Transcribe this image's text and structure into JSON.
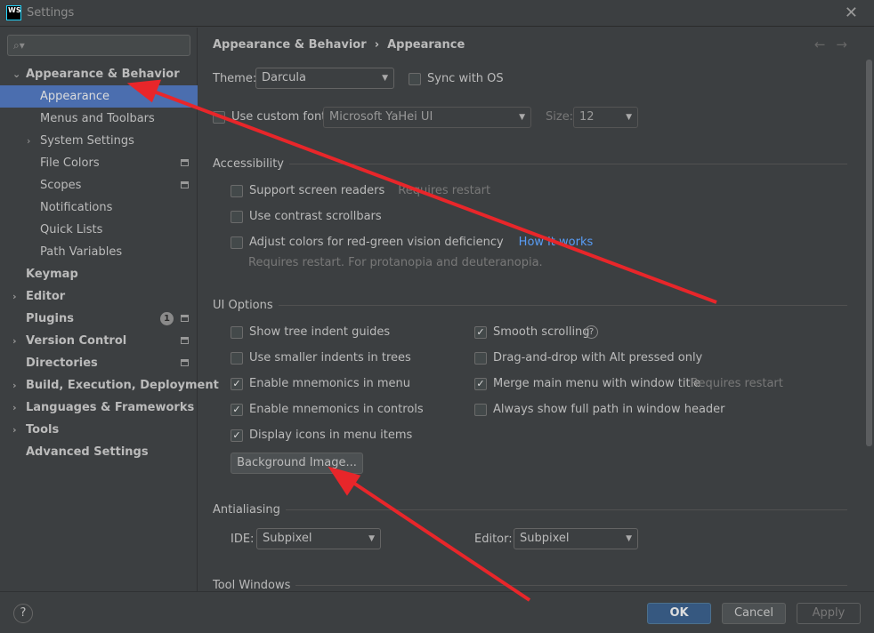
{
  "window": {
    "title": "Settings",
    "logo": "WS"
  },
  "sidebar": {
    "search_placeholder": "",
    "items": [
      {
        "label": "Appearance & Behavior",
        "level": 0,
        "bold": true,
        "expanded": true
      },
      {
        "label": "Appearance",
        "level": 1,
        "selected": true
      },
      {
        "label": "Menus and Toolbars",
        "level": 1
      },
      {
        "label": "System Settings",
        "level": 1,
        "collapsed": true
      },
      {
        "label": "File Colors",
        "level": 1,
        "icon": true
      },
      {
        "label": "Scopes",
        "level": 1,
        "icon": true
      },
      {
        "label": "Notifications",
        "level": 1
      },
      {
        "label": "Quick Lists",
        "level": 1
      },
      {
        "label": "Path Variables",
        "level": 1
      },
      {
        "label": "Keymap",
        "level": 0,
        "bold": true
      },
      {
        "label": "Editor",
        "level": 0,
        "bold": true,
        "collapsed": true
      },
      {
        "label": "Plugins",
        "level": 0,
        "bold": true,
        "badge": "1",
        "icon": true
      },
      {
        "label": "Version Control",
        "level": 0,
        "bold": true,
        "collapsed": true,
        "icon": true
      },
      {
        "label": "Directories",
        "level": 0,
        "bold": true,
        "icon": true
      },
      {
        "label": "Build, Execution, Deployment",
        "level": 0,
        "bold": true,
        "collapsed": true
      },
      {
        "label": "Languages & Frameworks",
        "level": 0,
        "bold": true,
        "collapsed": true
      },
      {
        "label": "Tools",
        "level": 0,
        "bold": true,
        "collapsed": true
      },
      {
        "label": "Advanced Settings",
        "level": 0,
        "bold": true
      }
    ]
  },
  "main": {
    "breadcrumb": [
      "Appearance & Behavior",
      "Appearance"
    ],
    "theme_label": "Theme:",
    "theme_value": "Darcula",
    "sync_os": "Sync with OS",
    "custom_font_label": "Use custom font:",
    "font_value": "Microsoft YaHei UI",
    "size_label": "Size:",
    "size_value": "12",
    "accessibility": {
      "title": "Accessibility",
      "screen_readers": "Support screen readers",
      "requires_restart": "Requires restart",
      "contrast": "Use contrast scrollbars",
      "redgreen": "Adjust colors for red-green vision deficiency",
      "how_it_works": "How it works",
      "redgreen_hint": "Requires restart. For protanopia and deuteranopia."
    },
    "ui_options": {
      "title": "UI Options",
      "left": [
        {
          "label": "Show tree indent guides",
          "checked": false
        },
        {
          "label": "Use smaller indents in trees",
          "checked": false
        },
        {
          "label": "Enable mnemonics in menu",
          "checked": true
        },
        {
          "label": "Enable mnemonics in controls",
          "checked": true
        },
        {
          "label": "Display icons in menu items",
          "checked": true
        }
      ],
      "right": [
        {
          "label": "Smooth scrolling",
          "checked": true
        },
        {
          "label": "Drag-and-drop with Alt pressed only",
          "checked": false
        },
        {
          "label": "Merge main menu with window title",
          "checked": true
        },
        {
          "label": "Always show full path in window header",
          "checked": false
        }
      ],
      "merge_hint": "Requires restart",
      "background_button": "Background Image..."
    },
    "antialiasing": {
      "title": "Antialiasing",
      "ide_label": "IDE:",
      "ide_value": "Subpixel",
      "editor_label": "Editor:",
      "editor_value": "Subpixel"
    },
    "tool_windows": {
      "title": "Tool Windows"
    }
  },
  "footer": {
    "ok": "OK",
    "cancel": "Cancel",
    "apply": "Apply",
    "help": "?"
  },
  "colors": {
    "selection": "#4b6eaf",
    "annotation_arrow": "#e8262a",
    "link": "#589df6"
  }
}
